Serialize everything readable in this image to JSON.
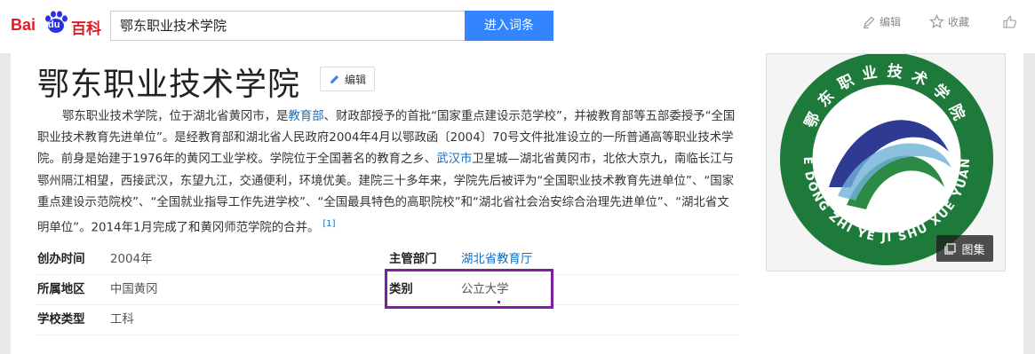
{
  "header": {
    "logo_bai": "Bai",
    "logo_du": "du",
    "logo_baike": "百科",
    "search_value": "鄂东职业技术学院",
    "search_button": "进入词条",
    "edit_label": "编辑",
    "collect_label": "收藏",
    "like_label": ""
  },
  "article": {
    "title": "鄂东职业技术学院",
    "edit_button": "编辑",
    "summary_parts": {
      "p1": "鄂东职业技术学院，位于湖北省黄冈市，是",
      "link1": "教育部",
      "p2": "、财政部授予的首批“国家重点建设示范学校”，并被教育部等五部委授予“全国职业技术教育先进单位”。是经教育部和湖北省人民政府2004年4月以鄂政函〔2004〕70号文件批准设立的一所普通高等职业技术学院。前身是始建于1976年的黄冈工业学校。学院位于全国著名的教育之乡、",
      "link2": "武汉市",
      "p3": "卫星城—湖北省黄冈市，北依大京九，南临长江与鄂州隔江相望，西接武汉，东望九江，交通便利，环境优美。建院三十多年来，学院先后被评为“全国职业技术教育先进单位”、“国家重点建设示范院校”、“全国就业指导工作先进学校”、“全国最具特色的高职院校”和“湖北省社会治安综合治理先进单位”、“湖北省文明单位”。2014年1月完成了和黄冈师范学院的合并。",
      "ref": "[1]"
    }
  },
  "basic_info": {
    "founded_label": "创办时间",
    "founded_value": "2004年",
    "dept_label": "主管部门",
    "dept_value": "湖北省教育厅",
    "region_label": "所属地区",
    "region_value": "中国黄冈",
    "category_label": "类别",
    "category_value": "公立大学",
    "type_label": "学校类型",
    "type_value": "工科"
  },
  "picture": {
    "emblem_bottom_text": "E DONG ZHI YE JI SHU XUE YUAN",
    "emblem_top_text": "鄂东职业技术学院",
    "gallery_button": "图集"
  },
  "colors": {
    "brand_red": "#de1c24",
    "brand_blue": "#2932e1",
    "button_blue": "#3385ff",
    "link_blue": "#136ec2",
    "emblem_green": "#1e7a3a",
    "highlight_purple": "#7b1ea0"
  }
}
